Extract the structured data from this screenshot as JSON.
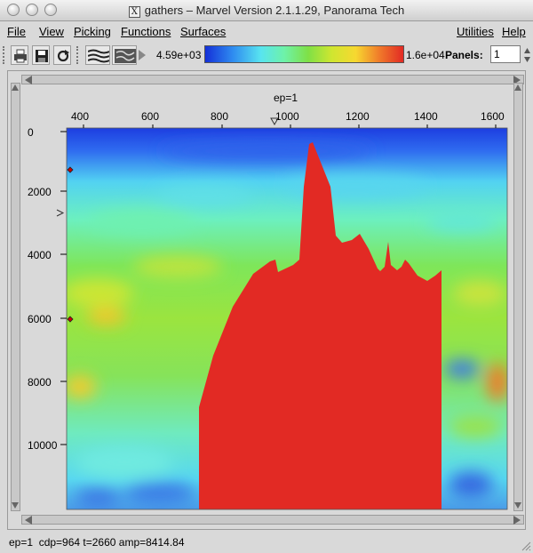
{
  "window": {
    "title": "gathers – Marvel Version 2.1.1.29, Panorama Tech",
    "x_icon": "X"
  },
  "menu": {
    "file": "File",
    "view": "View",
    "picking": "Picking",
    "functions": "Functions",
    "surfaces": "Surfaces",
    "utilities": "Utilities",
    "help": "Help"
  },
  "toolbar": {
    "icons": [
      "print-icon",
      "save-icon",
      "refresh-icon",
      "wiggle-display-icon",
      "density-display-icon",
      "play-icon"
    ],
    "scale_min": "4.59e+03",
    "scale_max": "1.6e+04",
    "panels_label": "Panels:",
    "panels_value": "1",
    "colormap": [
      "#1430d8",
      "#2f8cf0",
      "#58e4f0",
      "#6ef2a8",
      "#7fe046",
      "#d0e630",
      "#f7d830",
      "#f07a2a",
      "#e22a24"
    ]
  },
  "plot": {
    "title": "ep=1",
    "x_ticks": [
      "400",
      "600",
      "800",
      "1000",
      "1200",
      "1400",
      "1600"
    ],
    "y_ticks": [
      "0",
      "2000",
      "4000",
      "6000",
      "8000",
      "10000"
    ],
    "clip_color": "#e22a24"
  },
  "status": {
    "text": "ep=1  cdp=964 t=2660 amp=8414.84"
  }
}
